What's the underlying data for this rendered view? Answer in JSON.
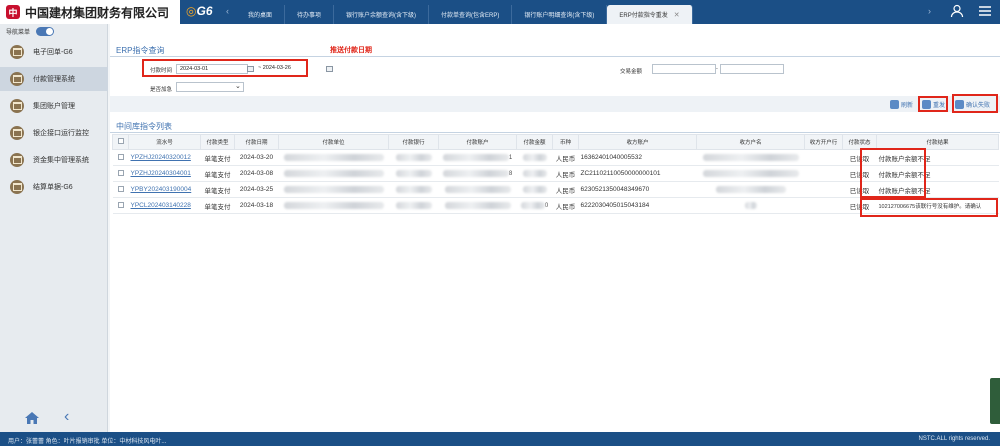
{
  "header": {
    "logo_glyph": "中",
    "company_name": "中国建材集团财务有限公司",
    "brand": "G6",
    "tabs": [
      {
        "label": "我的桌面"
      },
      {
        "label": "待办事项"
      },
      {
        "label": "银行账户余额查询(含下级)"
      },
      {
        "label": "付款单查询(包含ERP)"
      },
      {
        "label": "银行账户明细查询(含下级)"
      },
      {
        "label": "ERP付款指令重发",
        "active": true
      }
    ]
  },
  "sidebar": {
    "nav_menu_label": "导航菜单",
    "items": [
      {
        "label": "电子回单-G6"
      },
      {
        "label": "付款管理系统",
        "active": true
      },
      {
        "label": "集团账户管理"
      },
      {
        "label": "银企接口运行监控"
      },
      {
        "label": "资金集中管理系统"
      },
      {
        "label": "结算单据-G6"
      }
    ]
  },
  "query": {
    "title": "ERP指令查询",
    "annotation": "推送付款日期",
    "payment_time_label": "付款时间",
    "date_from": "2024-03-01",
    "date_to": "~ 2024-03-26",
    "amount_label": "交易金额",
    "amount_sep": "-",
    "retry_label": "是否加急",
    "retry_value": ""
  },
  "toolbar": {
    "refresh": "刷新",
    "resend": "重发",
    "confirm_fail": "确认失败"
  },
  "table": {
    "title": "中间库指令列表",
    "columns": [
      "流水号",
      "付款类型",
      "付款日期",
      "付款单位",
      "付款银行",
      "付款账户",
      "付款金额",
      "币种",
      "收方账户",
      "收方户名",
      "收方开户行",
      "付款状态",
      "付款结果"
    ],
    "rows": [
      {
        "serial": "YPZHJ20240320012",
        "type": "单笔支付",
        "date": "2024-03-20",
        "acct_tail": "1",
        "amt_tail": "",
        "currency": "人民币",
        "payee_acct": "16362401040005532",
        "status": "已读取",
        "result": "付款账户余额不足"
      },
      {
        "serial": "YPZHJ20240304001",
        "type": "单笔支付",
        "date": "2024-03-08",
        "acct_tail": "8",
        "amt_tail": "",
        "currency": "人民币",
        "payee_acct": "ZC21102110050000000101",
        "status": "已读取",
        "result": "付款账户余额不足"
      },
      {
        "serial": "YPBY202403190004",
        "type": "单笔支付",
        "date": "2024-03-25",
        "acct_tail": "",
        "amt_tail": "",
        "currency": "人民币",
        "payee_acct": "6230521350048349670",
        "status": "已读取",
        "result": "付款账户余额不足"
      },
      {
        "serial": "YPCL202403140228",
        "type": "单笔支付",
        "date": "2024-03-18",
        "acct_tail": "",
        "amt_tail": "0",
        "currency": "人民币",
        "payee_acct": "6222030405015043184",
        "status": "已读取",
        "result": "102127006675该联行号没有维护。请确认"
      }
    ]
  },
  "status": {
    "user_info": "用户：张蕾蕾   角色：叶片报销审批   单位：中材科技风电叶...",
    "rights": "NSTC.ALL rights reserved."
  },
  "colors": {
    "header_bg": "#1b4f86",
    "accent_red": "#e0261a",
    "link_blue": "#3f72b0",
    "brand_orange": "#f5a623"
  },
  "icons": [
    "user-icon",
    "menu-icon",
    "home-icon",
    "back-icon",
    "refresh-icon",
    "resend-icon",
    "confirm-fail-icon",
    "calendar-icon"
  ]
}
